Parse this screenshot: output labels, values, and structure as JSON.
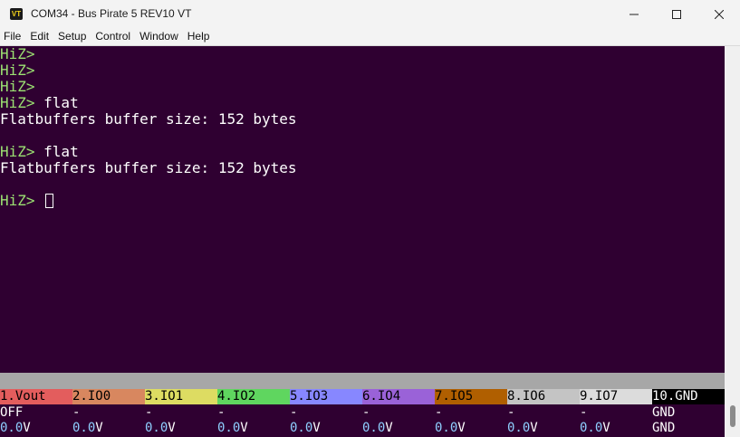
{
  "window": {
    "icon_text": "VT",
    "title": "COM34 - Bus Pirate 5 REV10 VT"
  },
  "menu": [
    "File",
    "Edit",
    "Setup",
    "Control",
    "Window",
    "Help"
  ],
  "terminal": {
    "lines": [
      {
        "prompt": "HiZ>",
        "text": ""
      },
      {
        "prompt": "HiZ>",
        "text": ""
      },
      {
        "prompt": "HiZ>",
        "text": ""
      },
      {
        "prompt": "HiZ>",
        "text": " flat"
      },
      {
        "prompt": "",
        "text": "Flatbuffers buffer size: 152 bytes"
      },
      {
        "prompt": "",
        "text": ""
      },
      {
        "prompt": "HiZ>",
        "text": " flat"
      },
      {
        "prompt": "",
        "text": "Flatbuffers buffer size: 152 bytes"
      },
      {
        "prompt": "",
        "text": ""
      },
      {
        "prompt": "HiZ>",
        "text": " "
      }
    ]
  },
  "pins": [
    {
      "label": "1.Vout",
      "color": "#e35d5d",
      "state": "OFF",
      "voltage": "0.0",
      "unit": "V"
    },
    {
      "label": "2.IO0",
      "color": "#d8875f",
      "state": "-",
      "voltage": "0.0",
      "unit": "V"
    },
    {
      "label": "3.IO1",
      "color": "#dddc62",
      "state": "-",
      "voltage": "0.0",
      "unit": "V"
    },
    {
      "label": "4.IO2",
      "color": "#5fd65f",
      "state": "-",
      "voltage": "0.0",
      "unit": "V"
    },
    {
      "label": "5.IO3",
      "color": "#8787ff",
      "state": "-",
      "voltage": "0.0",
      "unit": "V"
    },
    {
      "label": "6.IO4",
      "color": "#9a62d8",
      "state": "-",
      "voltage": "0.0",
      "unit": "V"
    },
    {
      "label": "7.IO5",
      "color": "#b05f00",
      "state": "-",
      "voltage": "0.0",
      "unit": "V"
    },
    {
      "label": "8.IO6",
      "color": "#c4c4c4",
      "state": "-",
      "voltage": "0.0",
      "unit": "V"
    },
    {
      "label": "9.IO7",
      "color": "#dcdcdc",
      "state": "-",
      "voltage": "0.0",
      "unit": "V"
    },
    {
      "label": "10.GND",
      "color": "#000000",
      "text_color": "#ffffff",
      "state": "GND",
      "voltage": "GND",
      "unit": ""
    }
  ],
  "colors": {
    "terminal_bg": "#2f0031",
    "prompt": "#9be072",
    "voltage": "#8fd0ff"
  }
}
